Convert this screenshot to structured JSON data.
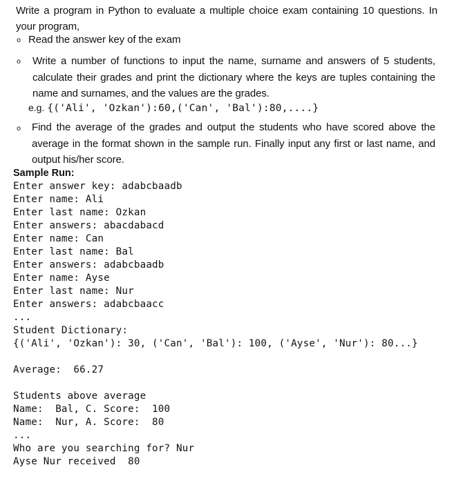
{
  "intro": "Write a program in Python to evaluate a multiple choice exam containing 10 questions. In your program,",
  "bullets": [
    {
      "marker": "o",
      "text": "Read the answer key of the exam"
    },
    {
      "marker": "o",
      "text": "Write a number of functions to input the name, surname and answers of 5 students, calculate their grades and print the dictionary where the keys are tuples containing the name and surnames, and the values are the grades."
    },
    {
      "marker": "o",
      "text": "Find the average of the grades and output the students who have scored above the average in the format shown in the sample run. Finally input any first or last name, and output his/her score."
    }
  ],
  "example": {
    "prefix": "e.g.",
    "code": "{('Ali', 'Ozkan'):60,('Can', 'Bal'):80,....}"
  },
  "sample_run": {
    "label": "Sample Run:",
    "lines": [
      "Enter answer key: adabcbaadb",
      "Enter name: Ali",
      "Enter last name: Ozkan",
      "Enter answers: abacdabacd",
      "Enter name: Can",
      "Enter last name: Bal",
      "Enter answers: adabcbaadb",
      "Enter name: Ayse",
      "Enter last name: Nur",
      "Enter answers: adabcbaacc",
      "...",
      "Student Dictionary:",
      "{('Ali', 'Ozkan'): 30, ('Can', 'Bal'): 100, ('Ayse', 'Nur'): 80...}",
      "",
      "Average:  66.27",
      "",
      "Students above average",
      "Name:  Bal, C. Score:  100",
      "Name:  Nur, A. Score:  80",
      "...",
      "Who are you searching for? Nur",
      "Ayse Nur received  80"
    ]
  }
}
